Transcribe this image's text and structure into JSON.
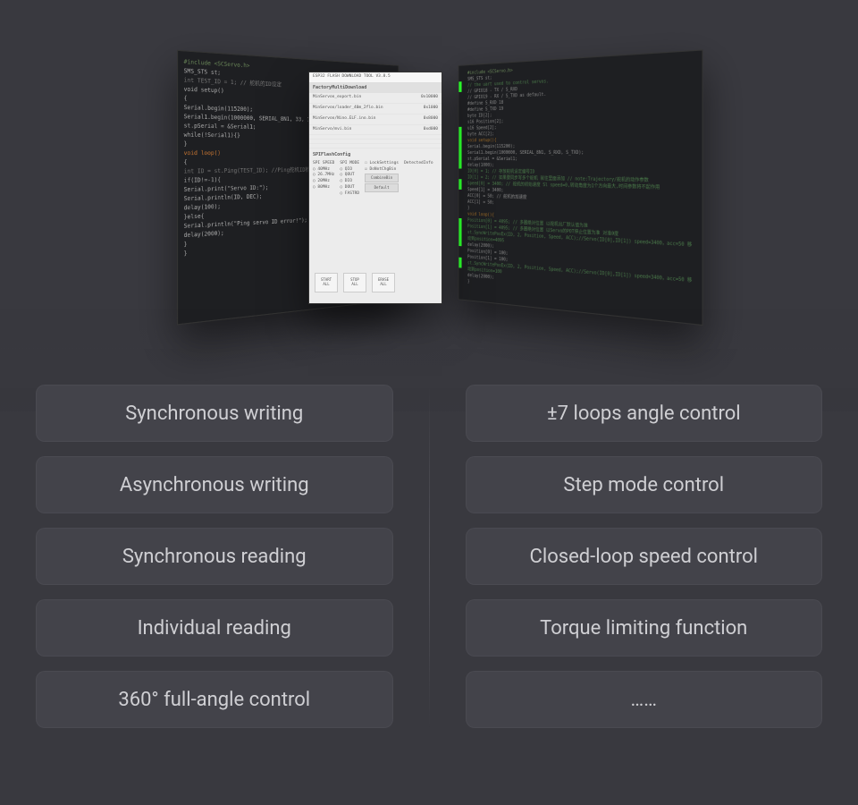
{
  "stage": {
    "left_code": {
      "lines": [
        {
          "t": "#include <SCServo.h>",
          "cls": "st"
        },
        {
          "t": "SMS_STS st;"
        },
        {
          "t": "int TEST_ID = 1;  // 舵机的ID设定",
          "cls": "cm"
        },
        {
          "t": "void setup()"
        },
        {
          "t": "{"
        },
        {
          "t": "  Serial.begin(115200);"
        },
        {
          "t": "  Serial1.begin(1000000, SERIAL_8N1, 33, 32);"
        },
        {
          "t": "  st.pSerial = &Serial1;"
        },
        {
          "t": "  while(!Serial1){}"
        },
        {
          "t": "}"
        },
        {
          "t": ""
        },
        {
          "t": "void loop()",
          "cls": "kw"
        },
        {
          "t": "{"
        },
        {
          "t": "  int ID = st.Ping(TEST_ID);  //Ping舵机ID检测",
          "cls": "cm"
        },
        {
          "t": "  if(ID!=-1){"
        },
        {
          "t": "    Serial.print(\"Servo ID:\");"
        },
        {
          "t": "    Serial.println(ID, DEC);"
        },
        {
          "t": "    delay(100);"
        },
        {
          "t": "  }else{"
        },
        {
          "t": "    Serial.println(\"Ping servo ID error!\");"
        },
        {
          "t": "    delay(2000);"
        },
        {
          "t": "  }"
        },
        {
          "t": "}"
        }
      ]
    },
    "center_tool": {
      "title": "ESP32 FLASH DOWNLOAD TOOL V3.8.5",
      "tab": "FactoryMultiDownload",
      "files": [
        {
          "name": "MinServoo_export.bin",
          "addr": "0x10000"
        },
        {
          "name": "MinServoo/loader_40m_2flo.bin",
          "addr": "0x1000"
        },
        {
          "name": "MinServoo/Nino.ELF.ino.bin",
          "addr": "0x8000"
        },
        {
          "name": "MinServo/mvi.bin",
          "addr": "0xd000"
        }
      ],
      "section": "SPIFlashConfig",
      "cols": [
        "SPI SPEED",
        "SPI MODE"
      ],
      "speeds": [
        "40MHz",
        "26.7MHz",
        "20MHz",
        "80MHz"
      ],
      "modes": [
        "QIO",
        "QOUT",
        "DIO",
        "DOUT",
        "FASTRD"
      ],
      "side_label": "DetectedInfo",
      "chk1": "DoNotChgBin",
      "chk2": "LockSettings",
      "sidebtns": [
        "CombineBin",
        "Default"
      ],
      "buttons": [
        "START ALL",
        "STOP ALL",
        "ERASE ALL"
      ]
    },
    "right_code": {
      "bars": [
        18,
        70,
        82,
        94,
        106,
        130,
        175,
        185,
        195,
        220
      ],
      "lines": [
        {
          "t": "#include <SCServo.h>",
          "cls": "st"
        },
        {
          "t": "SMS_STS st;"
        },
        {
          "t": ""
        },
        {
          "t": "// the uart used to control servos.",
          "cls": "cm"
        },
        {
          "t": "// GPIO18 - TX / S_RXD"
        },
        {
          "t": "// GPIO19 - RX / S_TXD as default."
        },
        {
          "t": "#define S_RXD 18"
        },
        {
          "t": "#define S_TXD 19"
        },
        {
          "t": ""
        },
        {
          "t": "byte ID[2];"
        },
        {
          "t": "s16 Position[2];"
        },
        {
          "t": "u16 Speed[2];"
        },
        {
          "t": "byte ACC[2];"
        },
        {
          "t": ""
        },
        {
          "t": "void setup(){",
          "cls": "kw"
        },
        {
          "t": "  Serial.begin(115200);"
        },
        {
          "t": "  Serial1.begin(1000000, SERIAL_8N1, S_RXD, S_TXD);"
        },
        {
          "t": "  st.pSerial = &Serial1;"
        },
        {
          "t": "  delay(1000);"
        },
        {
          "t": "  ID[0] = 1;    // 存放舵机设定编号ID",
          "cls": "cm"
        },
        {
          "t": "  ID[1] = 2;    // 如果要同步写多个舵机 就往里面添加 // note:Trajectory/舵机的动作参数",
          "cls": "cm"
        },
        {
          "t": "  Speed[0] = 3400;  // 舵机的初始速度 Sl speed=0,转动角度为1个方向最大,时间参数将不起作用",
          "cls": "cm"
        },
        {
          "t": "  Speed[1] = 3400;"
        },
        {
          "t": "  ACC[0] = 50;   // 舵机的加速度"
        },
        {
          "t": "  ACC[1] = 50;"
        },
        {
          "t": "}"
        },
        {
          "t": ""
        },
        {
          "t": "void loop(){",
          "cls": "kw"
        },
        {
          "t": ""
        },
        {
          "t": "  Position[0] = 4095; // 多圈绝对位置 以舵机出厂默认值为准",
          "cls": "cm"
        },
        {
          "t": "  Position[1] = 4095; // 多圈绝对位置  以Servo的POT停止位置为准 对准0度",
          "cls": "cm"
        },
        {
          "t": "  st.SyncWritePosEx(ID, 2, Position, Speed, ACC);//Servo(ID[0],ID[1]) speed=3400，acc=50 移动到position=4095",
          "cls": "cm"
        },
        {
          "t": "  delay(2000);"
        },
        {
          "t": ""
        },
        {
          "t": "  Position[0] = 100;"
        },
        {
          "t": "  Position[1] = 100;"
        },
        {
          "t": "  st.SyncWritePosEx(ID, 2, Position, Speed, ACC);//Servo(ID[0],ID[1]) speed=3400，acc=50 移动到position=100",
          "cls": "cm"
        },
        {
          "t": "  delay(2000);"
        },
        {
          "t": "}"
        }
      ]
    }
  },
  "features": {
    "left": [
      "Synchronous writing",
      "Asynchronous writing",
      "Synchronous reading",
      "Individual reading",
      "360° full-angle control"
    ],
    "right": [
      "±7 loops angle control",
      "Step mode control",
      "Closed-loop speed control",
      "Torque limiting function",
      "……"
    ]
  }
}
